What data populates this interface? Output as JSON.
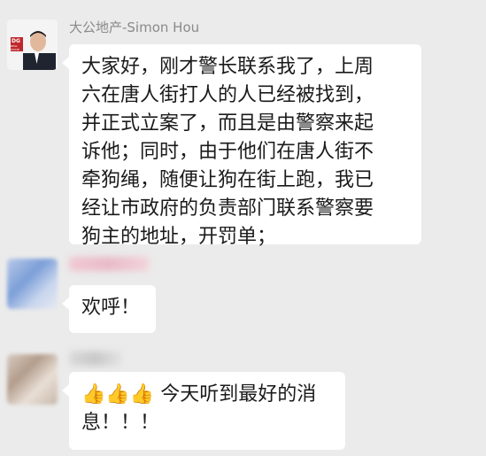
{
  "messages": [
    {
      "sender": "大公地产-Simon Hou",
      "avatar_text": [
        "DG",
        "REAL",
        "ESTATE"
      ],
      "lines": [
        "大家好，刚才警长联系我了，上周",
        "六在唐人街打人的人已经被找到，",
        "并正式立案了，而且是由警察来起",
        "诉他；同时，由于他们在唐人街不",
        "牵狗绳，随便让狗在街上跑，我已",
        "经让市政府的负责部门联系警察要",
        "狗主的地址，开罚单；"
      ]
    },
    {
      "sender": "",
      "text": "欢呼！"
    },
    {
      "sender": "",
      "emoji": [
        "👍",
        "👍",
        "👍"
      ],
      "line1": "今天听到最好的消",
      "line2": "息！！！"
    }
  ]
}
